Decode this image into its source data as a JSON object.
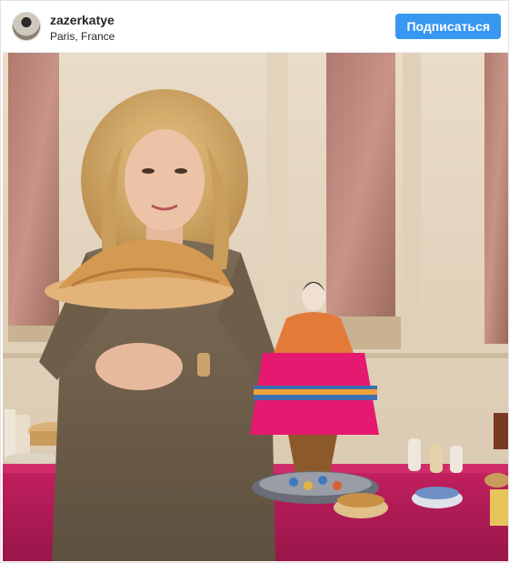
{
  "post": {
    "username": "zazerkatye",
    "location": "Paris, France",
    "follow_label": "Подписаться"
  },
  "icons": {
    "avatar": "profile-avatar",
    "photo": "post-photo"
  },
  "colors": {
    "follow_button": "#3897f0",
    "username_text": "#262626"
  }
}
